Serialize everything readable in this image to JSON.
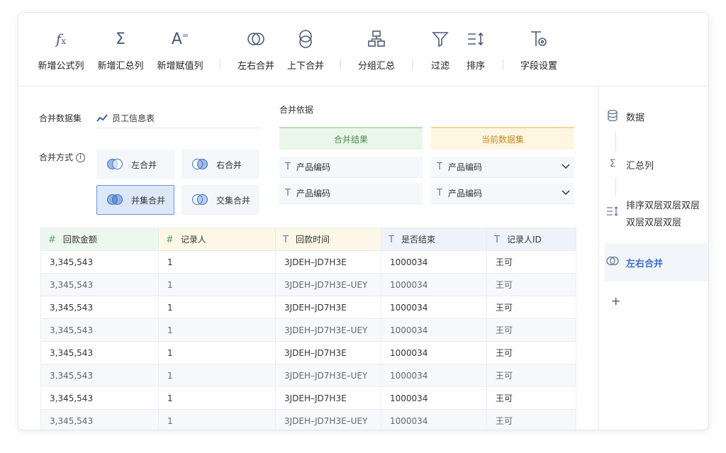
{
  "toolbar": {
    "items": [
      {
        "label": "新增公式列",
        "icon": "formula-icon"
      },
      {
        "label": "新增汇总列",
        "icon": "sigma-icon"
      },
      {
        "label": "新增赋值列",
        "icon": "assign-icon"
      },
      {
        "label": "左右合并",
        "icon": "venn-icon"
      },
      {
        "label": "上下合并",
        "icon": "union-vertical-icon"
      },
      {
        "label": "分组汇总",
        "icon": "group-icon"
      },
      {
        "label": "过滤",
        "icon": "filter-icon"
      },
      {
        "label": "排序",
        "icon": "sort-icon"
      },
      {
        "label": "字段设置",
        "icon": "field-settings-icon"
      }
    ]
  },
  "form": {
    "dataset_label": "合并数据集",
    "dataset_value": "员工信息表",
    "method_label": "合并方式",
    "methods": [
      "左合并",
      "右合并",
      "并集合并",
      "交集合并"
    ],
    "active_method": "并集合并",
    "basis_label": "合并依据",
    "result_header": "合并结果",
    "current_header": "当前数据集",
    "result_fields": [
      "产品编码",
      "产品编码"
    ],
    "current_fields": [
      "产品编码",
      "产品编码"
    ]
  },
  "table": {
    "columns": [
      {
        "icon": "#",
        "label": "回款金额"
      },
      {
        "icon": "#",
        "label": "记录人"
      },
      {
        "icon": "T",
        "label": "回款时间"
      },
      {
        "icon": "T",
        "label": "是否结束"
      },
      {
        "icon": "T",
        "label": "记录人ID"
      }
    ],
    "rows": [
      [
        "3,345,543",
        "1",
        "3JDEH–JD7H3E",
        "1000034",
        "王可"
      ],
      [
        "3,345,543",
        "1",
        "3JDEH–JD7H3E–UEY",
        "1000034",
        "王可"
      ],
      [
        "3,345,543",
        "1",
        "3JDEH–JD7H3E",
        "1000034",
        "王可"
      ],
      [
        "3,345,543",
        "1",
        "3JDEH–JD7H3E–UEY",
        "1000034",
        "王可"
      ],
      [
        "3,345,543",
        "1",
        "3JDEH–JD7H3E",
        "1000034",
        "王可"
      ],
      [
        "3,345,543",
        "1",
        "3JDEH–JD7H3E–UEY",
        "1000034",
        "王可"
      ],
      [
        "3,345,543",
        "1",
        "3JDEH–JD7H3E",
        "1000034",
        "王可"
      ],
      [
        "3,345,543",
        "1",
        "3JDEH–JD7H3E–UEY",
        "1000034",
        "王可"
      ]
    ]
  },
  "steps": {
    "items": [
      {
        "label": "数据",
        "icon": "database-icon"
      },
      {
        "label": "汇总列",
        "icon": "sigma-icon"
      },
      {
        "label": "排序双层双层双层双层双层双层",
        "icon": "sort-icon"
      },
      {
        "label": "左右合并",
        "icon": "venn-icon"
      }
    ],
    "add": "+"
  }
}
